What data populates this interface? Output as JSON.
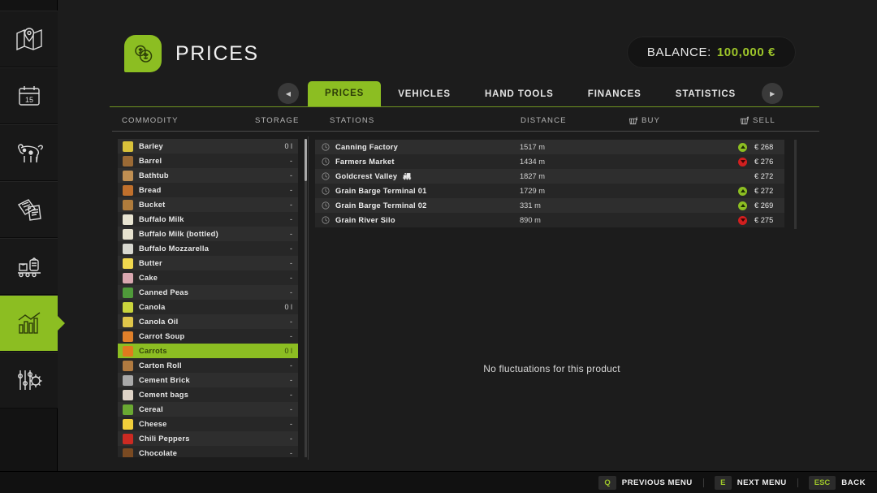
{
  "sidebar": {
    "items": [
      {
        "name": "map",
        "icon": "map-pin-icon",
        "active": false
      },
      {
        "name": "calendar",
        "icon": "calendar-icon",
        "active": false
      },
      {
        "name": "animals",
        "icon": "cow-icon",
        "active": false
      },
      {
        "name": "contracts",
        "icon": "documents-icon",
        "active": false
      },
      {
        "name": "production",
        "icon": "production-conveyor-icon",
        "active": false
      },
      {
        "name": "prices",
        "icon": "bar-chart-icon",
        "active": true
      },
      {
        "name": "settings",
        "icon": "sliders-gear-icon",
        "active": false
      }
    ]
  },
  "header": {
    "title": "PRICES",
    "logo_icon": "coins-icon",
    "accent_color": "#8cbe22",
    "balance": {
      "label": "BALANCE:",
      "value": "100,000 €"
    }
  },
  "tabs": {
    "prev_arrow": "◀",
    "next_arrow": "▶",
    "items": [
      {
        "label": "PRICES",
        "active": true
      },
      {
        "label": "VEHICLES",
        "active": false
      },
      {
        "label": "HAND TOOLS",
        "active": false
      },
      {
        "label": "FINANCES",
        "active": false
      },
      {
        "label": "STATISTICS",
        "active": false
      }
    ]
  },
  "columns": {
    "commodity": "COMMODITY",
    "storage": "STORAGE",
    "stations": "STATIONS",
    "distance": "DISTANCE",
    "buy": "BUY",
    "sell": "SELL",
    "buy_icon": "basket-down-icon",
    "sell_icon": "basket-up-icon"
  },
  "commodities": [
    {
      "name": "Barley",
      "storage": "0 l",
      "color": "#d9c23a",
      "selected": false
    },
    {
      "name": "Barrel",
      "storage": "-",
      "color": "#9b6a35",
      "selected": false
    },
    {
      "name": "Bathtub",
      "storage": "-",
      "color": "#c08f52",
      "selected": false
    },
    {
      "name": "Bread",
      "storage": "-",
      "color": "#c0702c",
      "selected": false
    },
    {
      "name": "Bucket",
      "storage": "-",
      "color": "#b07c3c",
      "selected": false
    },
    {
      "name": "Buffalo Milk",
      "storage": "-",
      "color": "#e8e4d2",
      "selected": false
    },
    {
      "name": "Buffalo Milk (bottled)",
      "storage": "-",
      "color": "#e6e2cf",
      "selected": false
    },
    {
      "name": "Buffalo Mozzarella",
      "storage": "-",
      "color": "#d8d8d0",
      "selected": false
    },
    {
      "name": "Butter",
      "storage": "-",
      "color": "#f0d84e",
      "selected": false
    },
    {
      "name": "Cake",
      "storage": "-",
      "color": "#d9a7b0",
      "selected": false
    },
    {
      "name": "Canned Peas",
      "storage": "-",
      "color": "#4f9a3a",
      "selected": false
    },
    {
      "name": "Canola",
      "storage": "0 l",
      "color": "#c9d43c",
      "selected": false
    },
    {
      "name": "Canola Oil",
      "storage": "-",
      "color": "#e0c64a",
      "selected": false
    },
    {
      "name": "Carrot Soup",
      "storage": "-",
      "color": "#e0802a",
      "selected": false
    },
    {
      "name": "Carrots",
      "storage": "0 l",
      "color": "#e07a1e",
      "selected": true
    },
    {
      "name": "Carton Roll",
      "storage": "-",
      "color": "#b07a40",
      "selected": false
    },
    {
      "name": "Cement Brick",
      "storage": "-",
      "color": "#a9a9a9",
      "selected": false
    },
    {
      "name": "Cement bags",
      "storage": "-",
      "color": "#ded3c6",
      "selected": false
    },
    {
      "name": "Cereal",
      "storage": "-",
      "color": "#6aa832",
      "selected": false
    },
    {
      "name": "Cheese",
      "storage": "-",
      "color": "#f2cf3b",
      "selected": false
    },
    {
      "name": "Chili Peppers",
      "storage": "-",
      "color": "#cc2a22",
      "selected": false
    },
    {
      "name": "Chocolate",
      "storage": "-",
      "color": "#7a4a22",
      "selected": false
    }
  ],
  "stations": [
    {
      "name": "Canning Factory",
      "distance": "1517 m",
      "trend": "up",
      "price": "€ 268",
      "train": false
    },
    {
      "name": "Farmers Market",
      "distance": "1434 m",
      "trend": "down",
      "price": "€ 276",
      "train": false
    },
    {
      "name": "Goldcrest Valley",
      "distance": "1827 m",
      "trend": "none",
      "price": "€ 272",
      "train": true
    },
    {
      "name": "Grain Barge Terminal 01",
      "distance": "1729 m",
      "trend": "up",
      "price": "€ 272",
      "train": false
    },
    {
      "name": "Grain Barge Terminal 02",
      "distance": "331 m",
      "trend": "up",
      "price": "€ 269",
      "train": false
    },
    {
      "name": "Grain River Silo",
      "distance": "890 m",
      "trend": "down",
      "price": "€ 275",
      "train": false
    }
  ],
  "chart_panel": {
    "empty_message": "No fluctuations for this product"
  },
  "bottom_bar": {
    "hints": [
      {
        "key": "Q",
        "label": "PREVIOUS MENU"
      },
      {
        "key": "E",
        "label": "NEXT MENU"
      },
      {
        "key": "ESC",
        "label": "BACK"
      }
    ]
  }
}
